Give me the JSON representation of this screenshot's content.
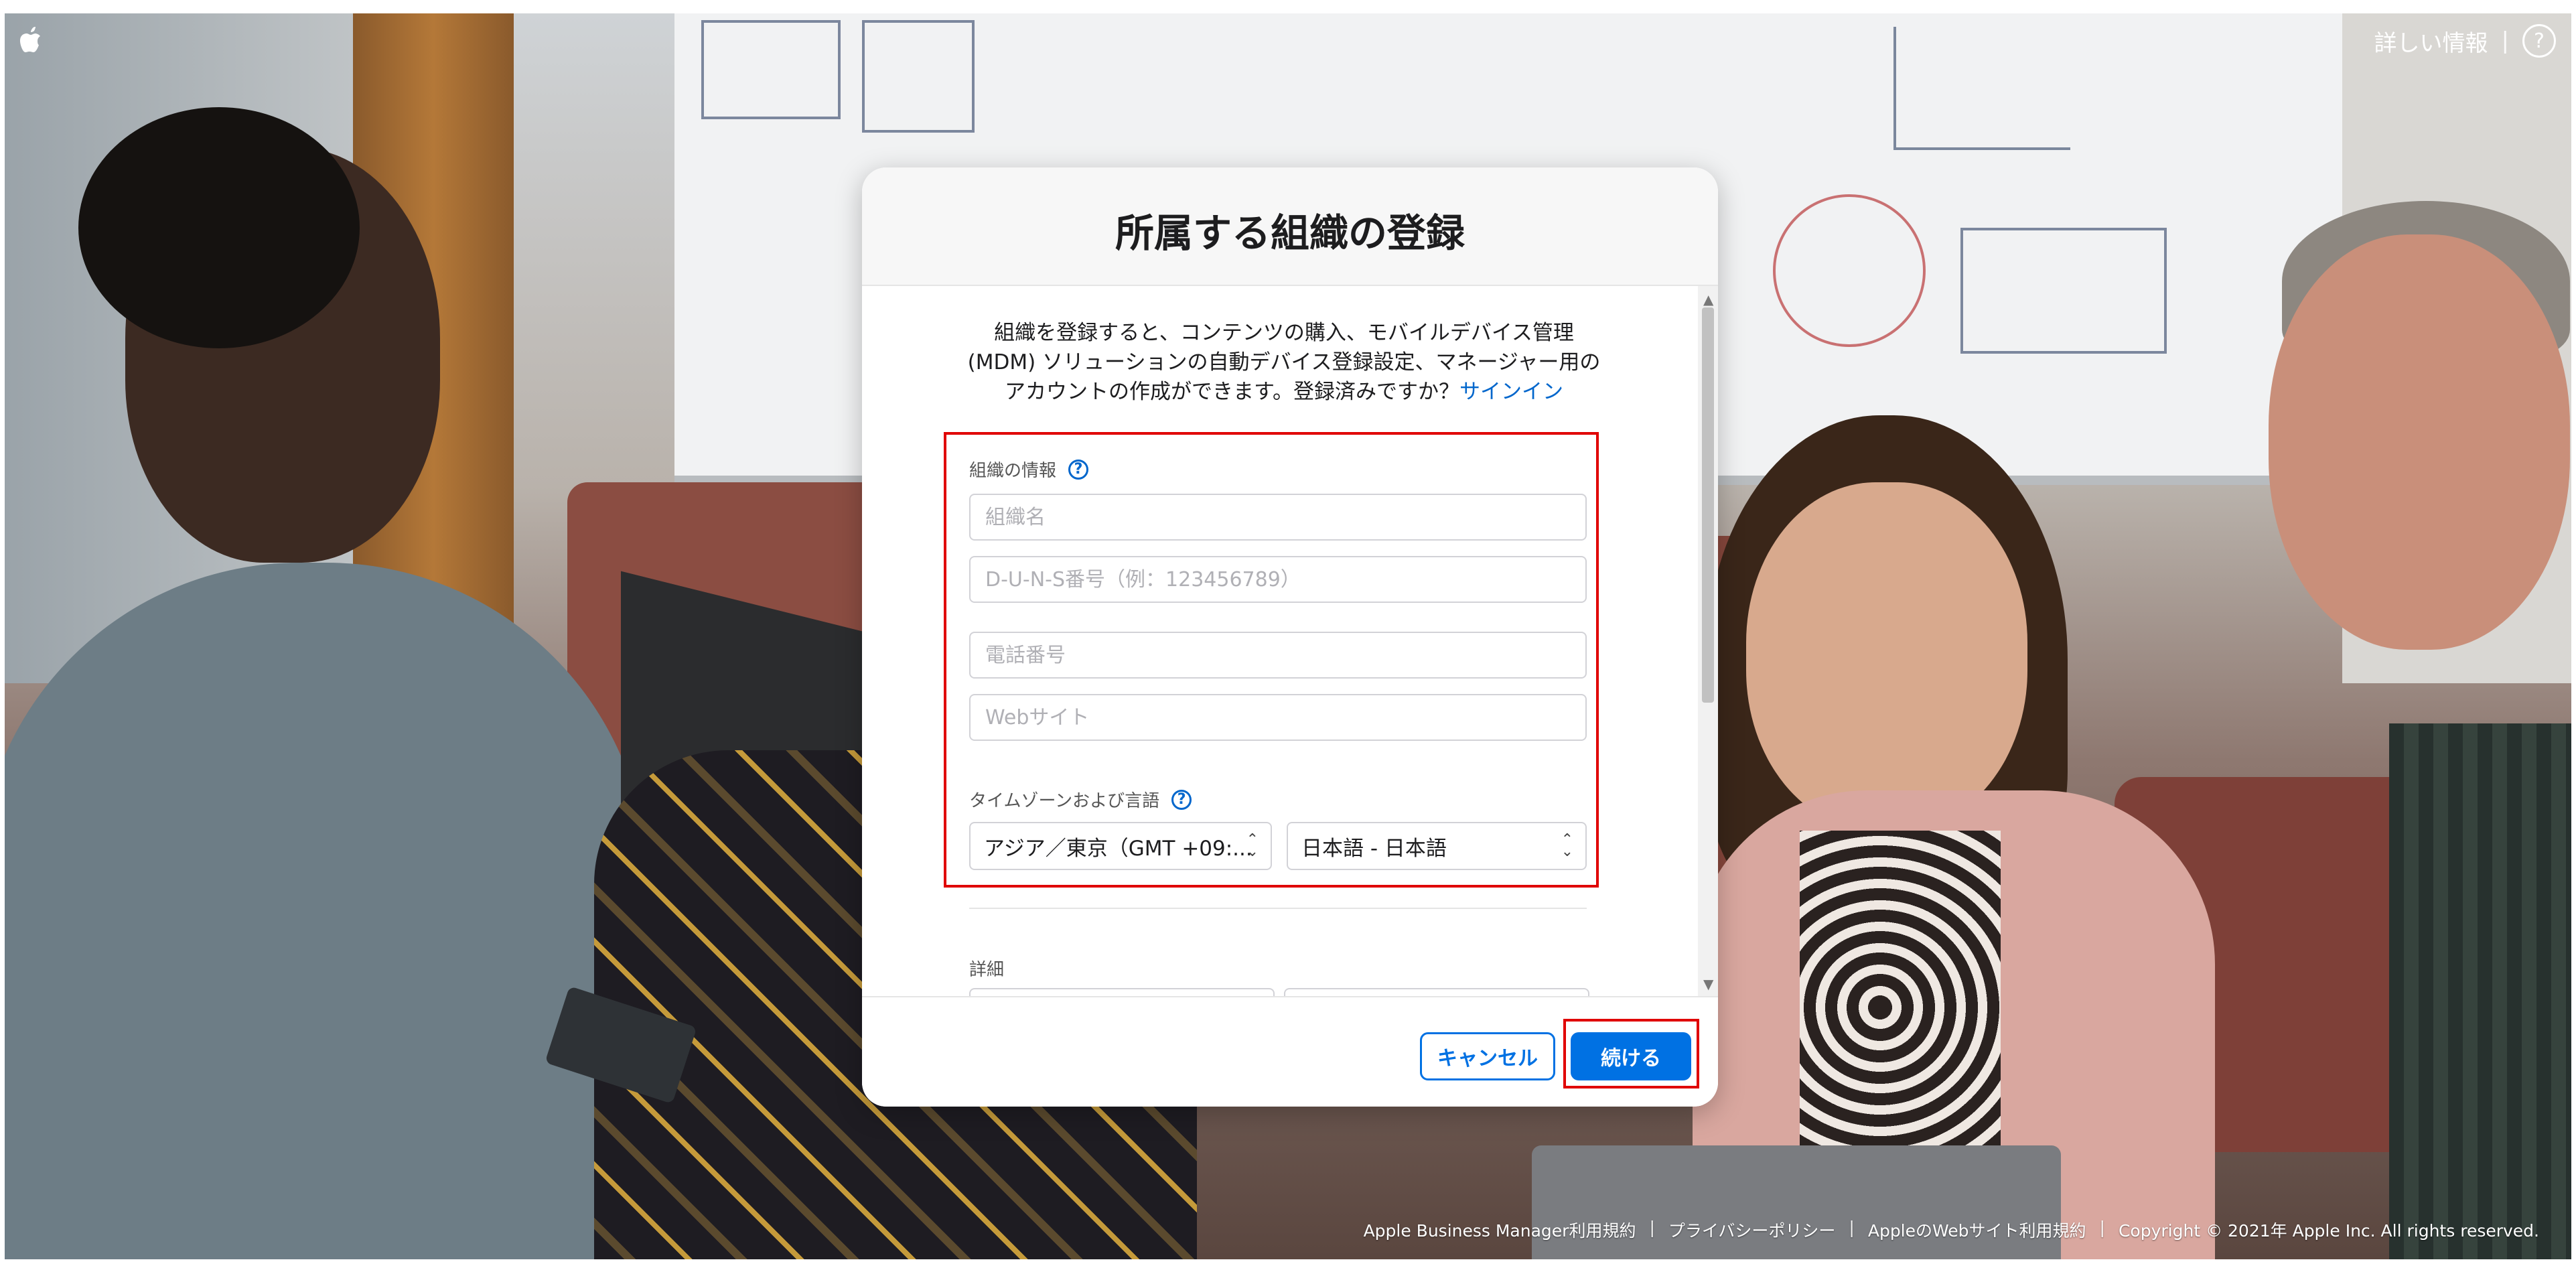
{
  "top_bar": {
    "more_info_label": "詳しい情報",
    "separator": "|",
    "help_glyph": "?",
    "logo_icon": "apple-logo-icon"
  },
  "modal": {
    "title": "所属する組織の登録",
    "intro_line1": "組織を登録すると、コンテンツの購入、モバイルデバイス管理",
    "intro_line2": "(MDM) ソリューションの自動デバイス登録設定、マネージャー用の",
    "intro_line3": "アカウントの作成ができます。登録済みですか？",
    "signin_link": "サインイン",
    "org_section": {
      "label": "組織の情報",
      "help_glyph": "?",
      "name_placeholder": "組織名",
      "duns_placeholder": "D-U-N-S番号（例：123456789）",
      "phone_placeholder": "電話番号",
      "website_placeholder": "Webサイト"
    },
    "tz_section": {
      "label": "タイムゾーンおよび言語",
      "help_glyph": "?",
      "timezone_value": "アジア／東京（GMT +09:...",
      "language_value": "日本語 - 日本語"
    },
    "details_label": "詳細",
    "cancel_label": "キャンセル",
    "continue_label": "続ける",
    "scroll_up_glyph": "▲",
    "scroll_down_glyph": "▼"
  },
  "footer": {
    "terms": "Apple Business Manager利用規約",
    "privacy": "プライバシーポリシー",
    "website_terms": "AppleのWebサイト利用規約",
    "copyright": "Copyright © 2021年 Apple Inc. All rights reserved.",
    "separator": "|"
  },
  "colors": {
    "accent": "#0071e3",
    "highlight_box": "#e00000",
    "link": "#0066cc"
  }
}
